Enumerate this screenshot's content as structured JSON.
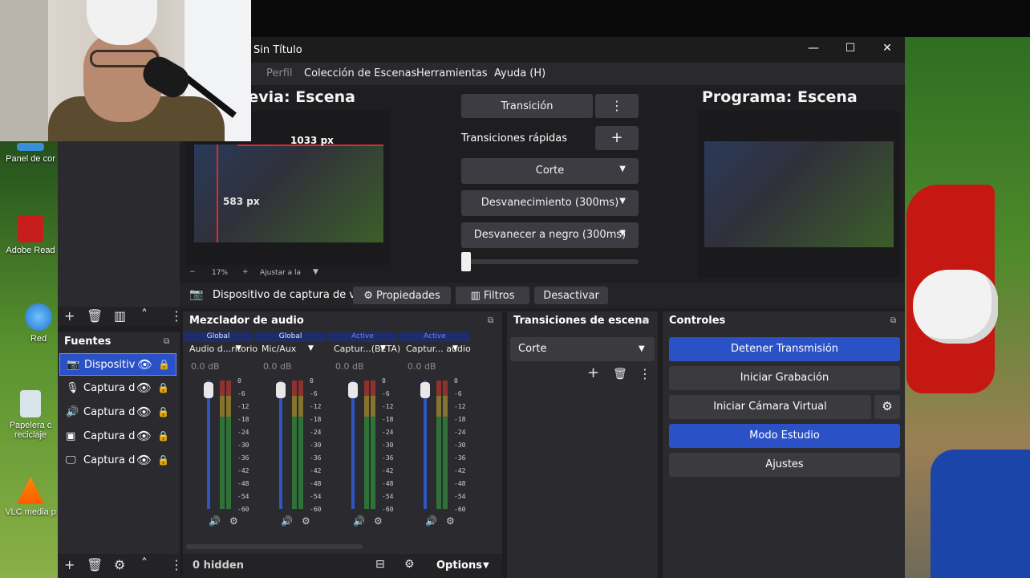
{
  "window": {
    "title": "Sin Título",
    "minimize": "—",
    "maximize": "☐",
    "close": "✕"
  },
  "menu": [
    "Perfil",
    "Colección de Escenas",
    "Herramientas",
    "Ayuda (H)"
  ],
  "menu_prefix": ")",
  "preview": {
    "title": "Vista previa: Escena",
    "title_visible": "revia: Escena",
    "width_label": "1033 px",
    "height_label": "583 px",
    "zoom": "17%",
    "zoom_fit": "Ajustar a la"
  },
  "program": {
    "title": "Programa: Escena"
  },
  "transition": {
    "button": "Transición",
    "quick_label": "Transiciones rápidas",
    "items": [
      "Corte",
      "Desvanecimiento (300ms)",
      "Desvanecer a negro (300ms)"
    ]
  },
  "source_toolbar": {
    "source": "Dispositivo de captura de v",
    "properties": "Propiedades",
    "filters": "Filtros",
    "deactivate": "Desactivar"
  },
  "sources": {
    "title": "Fuentes",
    "items": [
      {
        "label": "Dispositiv",
        "icon": "camera-icon"
      },
      {
        "label": "Captura d",
        "icon": "microphone-icon"
      },
      {
        "label": "Captura d",
        "icon": "speaker-icon"
      },
      {
        "label": "Captura d",
        "icon": "game-capture-icon"
      },
      {
        "label": "Captura d",
        "icon": "monitor-icon"
      }
    ]
  },
  "mixer": {
    "title": "Mezclador de audio",
    "channels": [
      {
        "tag": "Global",
        "name": "Audio d...ritorio",
        "db": "0.0 dB",
        "level": 0.95
      },
      {
        "tag": "Global",
        "name": "Mic/Aux",
        "db": "0.0 dB",
        "level": 0.95
      },
      {
        "tag": "Active",
        "name": "Captur...(BETA)",
        "db": "0.0 dB",
        "level": 0.95
      },
      {
        "tag": "Active",
        "name": "Captur... audio",
        "db": "0.0 dB",
        "level": 0.95
      }
    ],
    "ticks": [
      "0",
      "-6",
      "-12",
      "-18",
      "-24",
      "-30",
      "-36",
      "-42",
      "-48",
      "-54",
      "-60"
    ],
    "hidden": "0 hidden",
    "options": "Options"
  },
  "scene_transitions": {
    "title": "Transiciones de escena",
    "selected": "Corte"
  },
  "controls": {
    "title": "Controles",
    "buttons": [
      "Detener Transmisión",
      "Iniciar Grabación",
      "Iniciar Cámara Virtual",
      "Modo Estudio",
      "Ajustes"
    ]
  },
  "desktop_icons": [
    "Panel de cor",
    "Adobe Read",
    "Red",
    "Papelera c",
    "reciclaje",
    "VLC media p"
  ],
  "colors": {
    "accent": "#2b51c6",
    "panel": "#2b2b2f",
    "bg": "#1e1e21"
  }
}
